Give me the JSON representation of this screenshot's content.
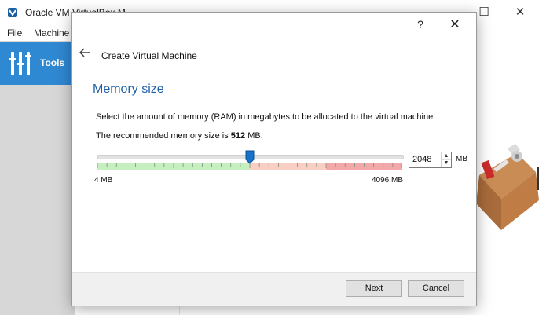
{
  "main_window": {
    "title": "Oracle VM VirtualBox Manager",
    "title_visible": "Oracle VM VirtualBox M",
    "minimize": "—",
    "maximize": "☐",
    "close": "✕",
    "menu": [
      "File",
      "Machine"
    ],
    "sidebar": {
      "tools_label": "Tools"
    }
  },
  "dialog": {
    "help": "?",
    "close": "✕",
    "title": "Create Virtual Machine",
    "section_title": "Memory size",
    "description": "Select the amount of memory (RAM) in megabytes to be allocated to the virtual machine.",
    "recommended_prefix": "The recommended memory size is ",
    "recommended_value": "512",
    "recommended_suffix": " MB.",
    "slider": {
      "min_label": "4 MB",
      "max_label": "4096 MB",
      "min_value": 4,
      "max_value": 4096,
      "current_value": 2048,
      "green_until": 2048,
      "amber_until": 3072
    },
    "spinbox_value": "2048",
    "unit": "MB",
    "next_label": "Next",
    "cancel_label": "Cancel"
  },
  "colors": {
    "accent_blue": "#2f88d2",
    "section_title": "#1f5fa8",
    "scale_green": "#c6efc0",
    "scale_amber": "#f8cfc2",
    "scale_red": "#f3a9a9"
  }
}
